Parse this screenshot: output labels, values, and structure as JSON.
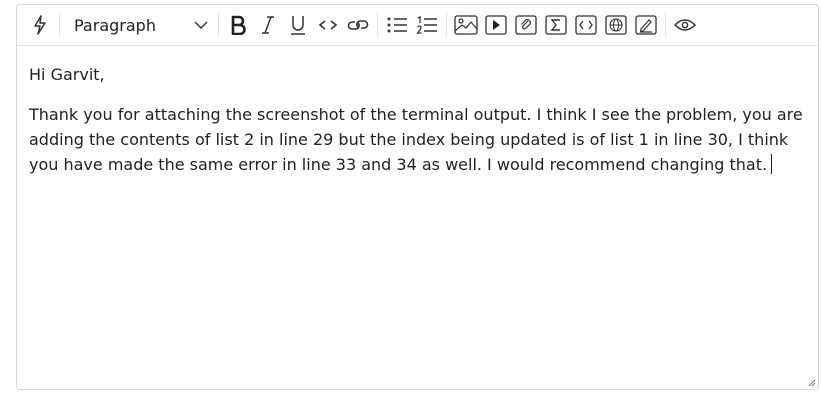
{
  "toolbar": {
    "block_format": "Paragraph",
    "buttons": [
      "ai-assist",
      "bold",
      "italic",
      "underline",
      "code",
      "link",
      "bulleted-list",
      "numbered-list",
      "image",
      "video",
      "attachment",
      "equation",
      "embed-code",
      "web-link",
      "drawing",
      "preview"
    ]
  },
  "message": {
    "greeting": "Hi Garvit,",
    "body": "Thank you for attaching the screenshot of the terminal output. I think I see the problem, you are adding the contents of list 2 in line 29 but the index being updated is of list 1 in line 30, I think you have made the same error in line 33 and 34 as well. I would recommend changing that."
  }
}
